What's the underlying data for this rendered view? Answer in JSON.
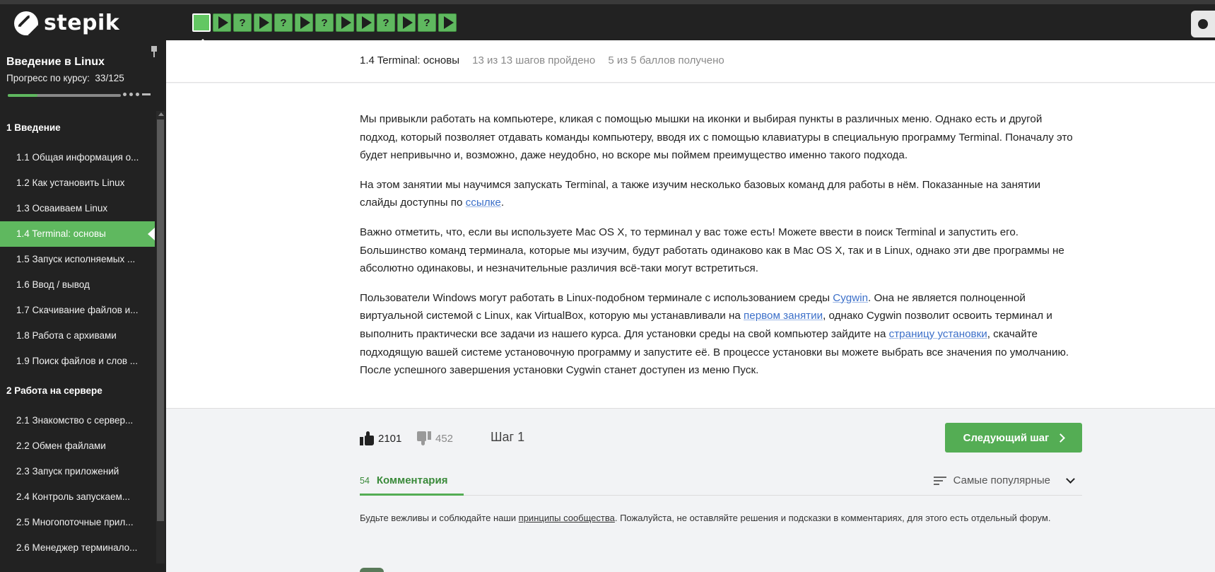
{
  "brand": {
    "name": "stepik"
  },
  "steps": [
    {
      "kind": "text",
      "label": ""
    },
    {
      "kind": "video",
      "label": ""
    },
    {
      "kind": "quiz",
      "label": "?"
    },
    {
      "kind": "video",
      "label": ""
    },
    {
      "kind": "quiz",
      "label": "?"
    },
    {
      "kind": "video",
      "label": ""
    },
    {
      "kind": "quiz",
      "label": "?"
    },
    {
      "kind": "video",
      "label": ""
    },
    {
      "kind": "video",
      "label": ""
    },
    {
      "kind": "quiz",
      "label": "?"
    },
    {
      "kind": "video",
      "label": ""
    },
    {
      "kind": "quiz",
      "label": "?"
    },
    {
      "kind": "video",
      "label": ""
    }
  ],
  "sidebar": {
    "course_title": "Введение в Linux",
    "progress_label": "Прогресс по курсу:",
    "progress_value": "33/125",
    "progress_fraction": 0.264,
    "sections": [
      {
        "title": "1  Введение",
        "lessons": [
          {
            "label": "1.1  Общая информация о..."
          },
          {
            "label": "1.2  Как установить Linux"
          },
          {
            "label": "1.3  Осваиваем Linux"
          },
          {
            "label": "1.4  Terminal: основы",
            "active": true
          },
          {
            "label": "1.5  Запуск исполняемых ..."
          },
          {
            "label": "1.6  Ввод / вывод"
          },
          {
            "label": "1.7  Скачивание файлов и..."
          },
          {
            "label": "1.8  Работа с архивами"
          },
          {
            "label": "1.9  Поиск файлов и слов ..."
          }
        ]
      },
      {
        "title": "2  Работа на сервере",
        "lessons": [
          {
            "label": "2.1  Знакомство с сервер..."
          },
          {
            "label": "2.2  Обмен файлами"
          },
          {
            "label": "2.3  Запуск приложений"
          },
          {
            "label": "2.4  Контроль запускаем..."
          },
          {
            "label": "2.5  Многопоточные прил..."
          },
          {
            "label": "2.6  Менеджер терминало..."
          }
        ]
      }
    ]
  },
  "header": {
    "lesson_name": "1.4 Terminal: основы",
    "steps_done": "13 из 13 шагов пройдено",
    "points": "5 из 5 баллов  получено"
  },
  "content": {
    "p1": "Мы привыкли работать на компьютере, кликая с помощью мышки на иконки и выбирая пункты в различных меню. Однако есть и другой подход, который позволяет отдавать команды компьютеру, вводя их с помощью клавиатуры в специальную программу Terminal. Поначалу это будет непривычно и, возможно, даже неудобно, но вскоре мы поймем преимущество именно такого подхода.",
    "p2_text": "На этом занятии мы научимся запускать Terminal, а также изучим несколько базовых команд для работы в нём. Показанные на занятии слайды доступны по ",
    "p2_link": "ссылке",
    "p2_end": ".",
    "p3": "Важно отметить, что, если вы используете Mac OS X, то терминал у вас тоже есть! Можете ввести в поиск Terminal и запустить его. Большинство команд терминала, которые мы изучим, будут работать одинаково как в Mac OS X, так и в Linux, однако эти две программы не абсолютно одинаковы, и незначительные различия всё-таки могут встретиться.",
    "p4_a": "Пользователи Windows могут работать в Linux-подобном терминале с использованием среды ",
    "p4_link1": "Cygwin",
    "p4_b": ". Она не является полноценной виртуальной системой с Linux, как VirtualBox, которую мы устанавливали на ",
    "p4_link2": "первом занятии",
    "p4_c": ", однако Cygwin позволит освоить терминал и выполнить практически все задачи из нашего курса. Для установки среды на свой компьютер зайдите на ",
    "p4_link3": "страницу установки",
    "p4_d": ", скачайте подходящую вашей системе установочную программу и запустите её. В процессе установки вы можете выбрать все значения по умолчанию. После успешного завершения установки Cygwin станет доступен из меню Пуск."
  },
  "footer": {
    "likes": "2101",
    "dislikes": "452",
    "step_label": "Шаг 1",
    "next_button": "Следующий шаг"
  },
  "comments": {
    "count": "54",
    "tab_label": "Комментария",
    "sort_label": "Самые популярные",
    "rules_a": "Будьте вежливы и соблюдайте наши ",
    "rules_link": "принципы сообщества",
    "rules_b": ". Пожалуйста, не оставляйте решения и подсказки в комментариях, для этого есть отдельный форум."
  },
  "colors": {
    "accent_green": "#54ad54",
    "sidebar_bg": "#222222",
    "link_blue": "#3b6fc9"
  }
}
